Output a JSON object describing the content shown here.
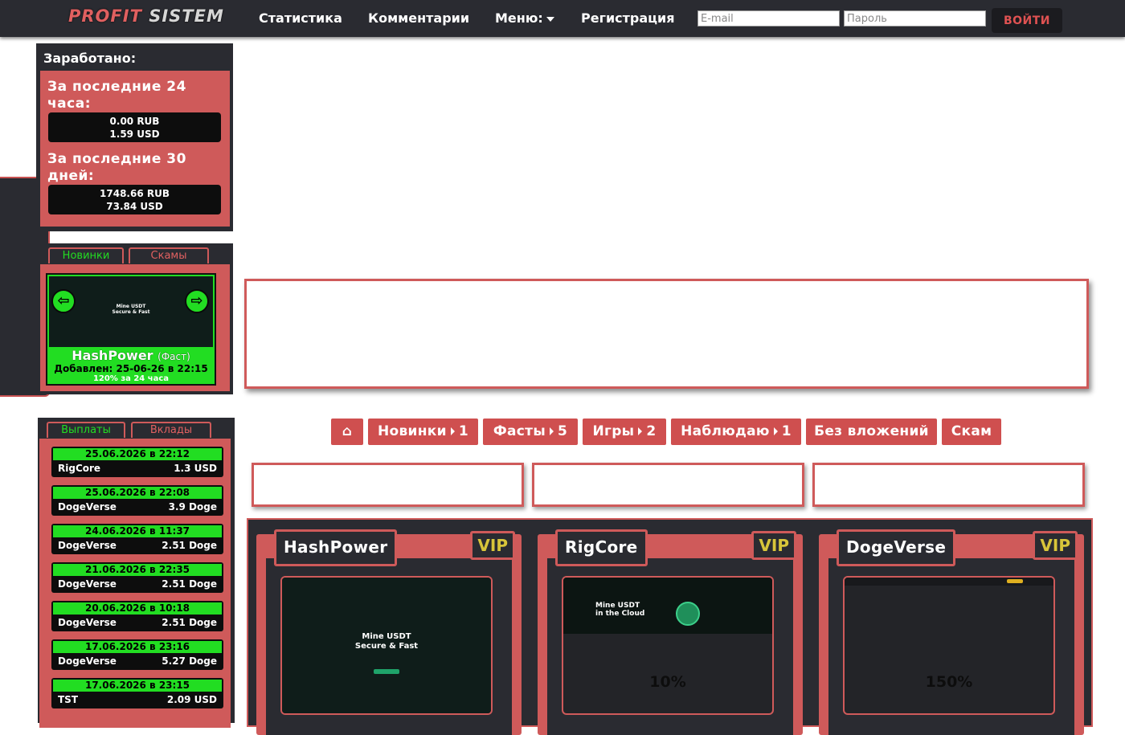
{
  "navbar": {
    "logo_part1": "PROFIT",
    "logo_part2": "SISTEM",
    "links": [
      "Статистика",
      "Комментарии",
      "Меню:",
      "Регистрация"
    ],
    "email_placeholder": "E-mail",
    "password_placeholder": "Пароль",
    "login_label": "ВОЙТИ"
  },
  "earned": {
    "title": "Заработано:",
    "period_24h_label": "За последние 24 часа:",
    "period_24h_rub": "0.00 RUB",
    "period_24h_usd": "1.59 USD",
    "period_30d_label": "За последние 30 дней:",
    "period_30d_rub": "1748.66 RUB",
    "period_30d_usd": "73.84 USD"
  },
  "news": {
    "tabs": [
      "Новинки",
      "Скамы"
    ],
    "card": {
      "name": "HashPower",
      "type": "(Фаст)",
      "added": "Добавлен: 25-06-26 в 22:15",
      "plan": "120% за 24 часа",
      "thumb_line1": "Mine USDT",
      "thumb_line2": "Secure & Fast"
    },
    "prev_arrow": "⇦",
    "next_arrow": "⇨"
  },
  "payouts": {
    "tabs": [
      "Выплаты",
      "Вклады"
    ],
    "rows": [
      {
        "date": "25.06.2026 в 22:12",
        "name": "RigCore",
        "amount": "1.3 USD"
      },
      {
        "date": "25.06.2026 в 22:08",
        "name": "DogeVerse",
        "amount": "3.9 Doge"
      },
      {
        "date": "24.06.2026 в 11:37",
        "name": "DogeVerse",
        "amount": "2.51 Doge"
      },
      {
        "date": "21.06.2026 в 22:35",
        "name": "DogeVerse",
        "amount": "2.51 Doge"
      },
      {
        "date": "20.06.2026 в 10:18",
        "name": "DogeVerse",
        "amount": "2.51 Doge"
      },
      {
        "date": "17.06.2026 в 23:16",
        "name": "DogeVerse",
        "amount": "5.27 Doge"
      },
      {
        "date": "17.06.2026 в 23:15",
        "name": "TST",
        "amount": "2.09 USD"
      }
    ]
  },
  "filters": {
    "home_icon": "⌂",
    "buttons": [
      {
        "label": "Новинки",
        "count": "1"
      },
      {
        "label": "Фасты",
        "count": "5"
      },
      {
        "label": "Игры",
        "count": "2"
      },
      {
        "label": "Наблюдаю",
        "count": "1"
      },
      {
        "label": "Без вложений",
        "count": ""
      },
      {
        "label": "Скам",
        "count": ""
      }
    ]
  },
  "projects": [
    {
      "name": "HashPower",
      "badge": "VIP",
      "percent": "",
      "shot_line1": "Mine USDT",
      "shot_line2": "Secure & Fast"
    },
    {
      "name": "RigCore",
      "badge": "VIP",
      "percent": "10%",
      "shot_line1": "Mine USDT",
      "shot_line2": "in the Cloud"
    },
    {
      "name": "DogeVerse",
      "badge": "VIP",
      "percent": "150%",
      "shot_line1": "",
      "shot_line2": ""
    }
  ],
  "colors": {
    "accent": "#cf5a5a",
    "dark": "#2a2b31",
    "green": "#22dd22",
    "vip": "#d8c53a"
  }
}
